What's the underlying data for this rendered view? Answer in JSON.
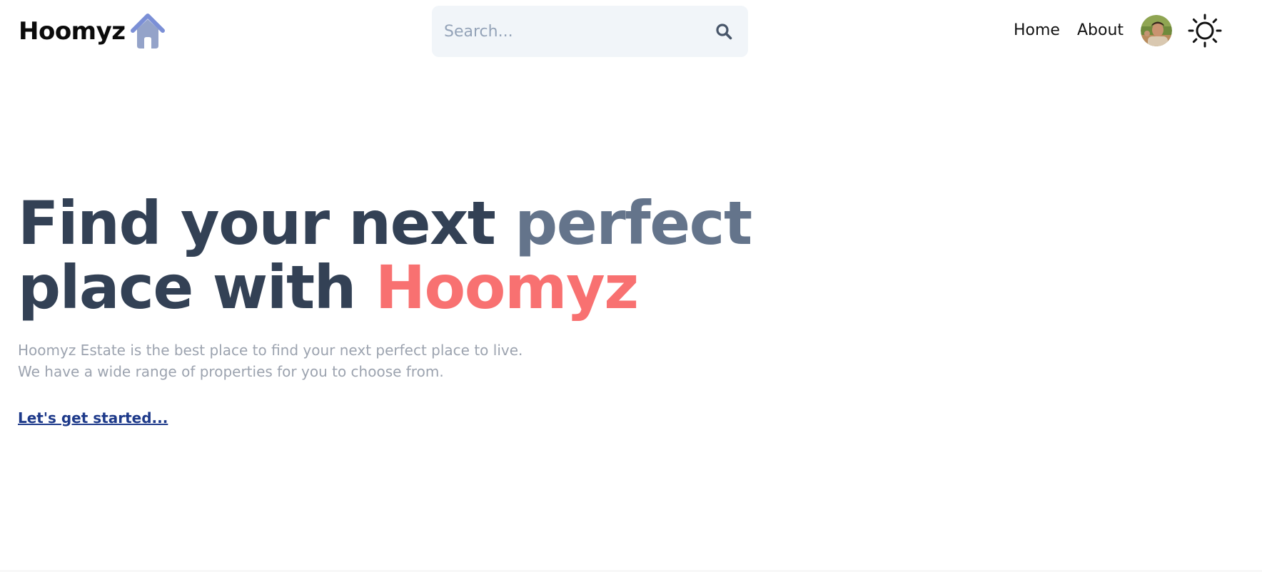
{
  "header": {
    "brand": "Hoomyz",
    "brand_logo_icon": "house-icon",
    "search": {
      "placeholder": "Search...",
      "value": "",
      "icon": "search-icon"
    },
    "nav": [
      {
        "label": "Home"
      },
      {
        "label": "About"
      }
    ],
    "avatar_icon": "user-avatar",
    "theme_toggle_icon": "sun-icon"
  },
  "hero": {
    "title_part1": "Find your next ",
    "title_accent": "perfect",
    "title_part2": "place with ",
    "title_brand": "Hoomyz",
    "desc_line1": "Hoomyz Estate is the best place to find your next perfect place to live.",
    "desc_line2": "We have a wide range of properties for you to choose from.",
    "cta": "Let's get started..."
  },
  "colors": {
    "title": "#334155",
    "accent": "#64748b",
    "brand": "#f87171",
    "description": "#9ca3af",
    "cta": "#1e3a8a",
    "search_bg": "#f1f5f9"
  }
}
